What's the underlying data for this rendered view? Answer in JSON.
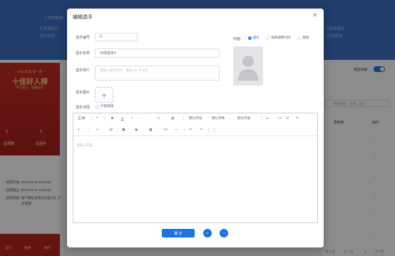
{
  "background": {
    "header_title": "1 选择赛事",
    "header_lines": [
      "生意编辑订",
      "常先弹窗"
    ],
    "header_right": [
      "2选择编辑",
      "示例编辑"
    ],
    "poster": {
      "subtitle": "— 2024年度·第一季 —",
      "title": "十佳好人榜",
      "slogan": "不忘初心 · 砥砺前行",
      "stats": [
        {
          "value": "0",
          "label": "总票数"
        },
        {
          "value": "6",
          "label": "总选手"
        },
        {
          "value": "0",
          "label": "访问量"
        }
      ]
    },
    "info_lines": [
      "· 投票开始: 2025-03-15 11:04:51",
      "· 投票截止: 2025-03-21 11:04:51",
      "· 投票规则: 每个微信号每天可投1次, 可",
      "字目票"
    ],
    "bottom_nav": [
      "首页",
      "我要",
      "排行"
    ],
    "right_panel": {
      "toggle_label": "预览效果",
      "search_placeholder": "搜索编号、名称、照片",
      "col_votes": "票数数",
      "col_actions": "操作",
      "dash": "—"
    },
    "pager": [
      "共 6 条",
      "上一页",
      "1",
      "下一页"
    ]
  },
  "modal": {
    "title": "编辑选手",
    "close_icon": "close-icon",
    "fields": {
      "number_label": "选手编号",
      "number_value": "5",
      "name_label": "选手名称",
      "name_value": "示例选手5",
      "intro_label": "选手简介",
      "intro_placeholder": "请输入选手简介，最多 50 字以内",
      "image_label": "选手图片",
      "detail_label": "选手详情",
      "external_link_label": "外部链接"
    },
    "cover": {
      "label": "封面:",
      "options": [
        "图片",
        "视频通用代码",
        "视频"
      ],
      "selected": "图片"
    },
    "toolbar": {
      "row1": [
        "正文",
        "❝",
        "B",
        "U",
        "I",
        "···",
        "A",
        "▨",
        "默认字号",
        "默认字体",
        "默认行高",
        "≔",
        "⋮≡",
        "☑",
        "✎"
      ],
      "row2": [
        "≡",
        "☺",
        "🔗",
        "▣",
        "▶",
        "▦",
        "</>",
        "—",
        "↶",
        "↷",
        "⛶"
      ]
    },
    "editor_placeholder": "请输入内容",
    "confirm_label": "确 定",
    "prev_icon": "arrow-left-circle-icon",
    "next_icon": "arrow-right-circle-icon",
    "accent_color": "#1a73e8"
  }
}
